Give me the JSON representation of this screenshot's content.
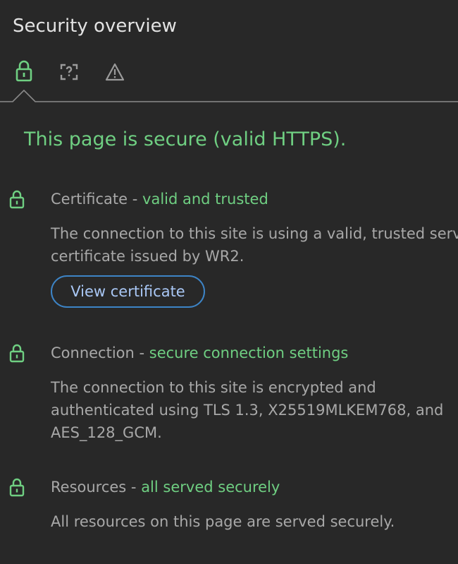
{
  "panel": {
    "title": "Security overview"
  },
  "tabs": [
    {
      "icon": "lock-icon",
      "active": true
    },
    {
      "icon": "unknown-security-icon",
      "active": false
    },
    {
      "icon": "warning-icon",
      "active": false
    }
  ],
  "summary": {
    "headline": "This page is secure (valid HTTPS)."
  },
  "sections": {
    "certificate": {
      "icon": "lock-icon",
      "label": "Certificate",
      "separator": " - ",
      "status": "valid and trusted",
      "description_lines": [
        "The connection to this site is using a valid, trusted server",
        "certificate issued by WR2."
      ],
      "button_label": "View certificate"
    },
    "connection": {
      "icon": "lock-icon",
      "label": "Connection",
      "separator": " - ",
      "status": "secure connection settings",
      "description_lines": [
        "The connection to this site is encrypted and",
        "authenticated using TLS 1.3, X25519MLKEM768, and",
        "AES_128_GCM."
      ]
    },
    "resources": {
      "icon": "lock-icon",
      "label": "Resources",
      "separator": " - ",
      "status": "all served securely",
      "description_lines": [
        "All resources on this page are served securely."
      ]
    }
  },
  "colors": {
    "background": "#282828",
    "secure_green": "#6fcf82",
    "text_muted": "#a8a8a8",
    "title_text": "#e3e3e3",
    "button_border": "#3d84c6",
    "button_text": "#a9c7f5"
  }
}
